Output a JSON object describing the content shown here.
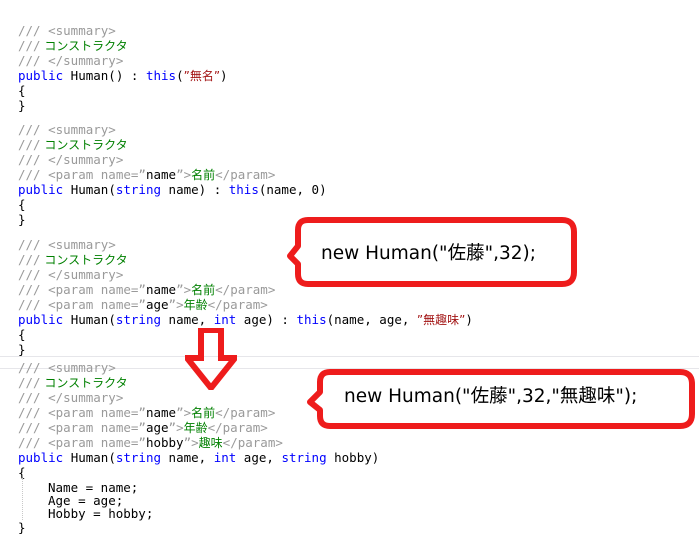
{
  "editor": {
    "language": "csharp",
    "background": "#ffffff",
    "colors": {
      "comment": "#9a9a9a",
      "comment_text": "#008000",
      "keyword": "#0000ff",
      "string": "#a31515",
      "plain": "#000000",
      "divider": "#e6e6ea",
      "indent_guide": "#c8c8c8",
      "annotation": "#ee1c1c"
    },
    "code_blocks": [
      {
        "name": "constructor-default",
        "lines": [
          {
            "slash": "///",
            "tag": " <summary>"
          },
          {
            "slash": "///",
            "jp": " コンストラクタ"
          },
          {
            "slash": "///",
            "tag": " </summary>"
          },
          {
            "signature": "public Human() : this(\"無名\")"
          },
          {
            "brace": "{"
          },
          {
            "brace": "}"
          }
        ]
      },
      {
        "name": "constructor-name",
        "lines": [
          {
            "slash": "///",
            "tag": " <summary>"
          },
          {
            "slash": "///",
            "jp": " コンストラクタ"
          },
          {
            "slash": "///",
            "tag": " </summary>"
          },
          {
            "slash": "///",
            "param": " <param name=\"name\">名前</param>"
          },
          {
            "signature": "public Human(string name) : this(name, 0)"
          },
          {
            "brace": "{"
          },
          {
            "brace": "}"
          }
        ]
      },
      {
        "name": "constructor-name-age",
        "lines": [
          {
            "slash": "///",
            "tag": " <summary>"
          },
          {
            "slash": "///",
            "jp": " コンストラクタ"
          },
          {
            "slash": "///",
            "tag": " </summary>"
          },
          {
            "slash": "///",
            "param": " <param name=\"name\">名前</param>"
          },
          {
            "slash": "///",
            "param": " <param name=\"age\">年齢</param>"
          },
          {
            "signature": "public Human(string name, int age) : this(name, age, \"無趣味\")"
          },
          {
            "brace": "{"
          },
          {
            "brace": "}"
          }
        ]
      },
      {
        "name": "constructor-name-age-hobby",
        "lines": [
          {
            "slash": "///",
            "tag": " <summary>"
          },
          {
            "slash": "///",
            "jp": " コンストラクタ"
          },
          {
            "slash": "///",
            "tag": " </summary>"
          },
          {
            "slash": "///",
            "param": " <param name=\"name\">名前</param>"
          },
          {
            "slash": "///",
            "param": " <param name=\"age\">年齢</param>"
          },
          {
            "slash": "///",
            "param": " <param name=\"hobby\">趣味</param>"
          },
          {
            "signature": "public Human(string name, int age, string hobby)"
          },
          {
            "brace": "{"
          },
          {
            "body": "Name = name;"
          },
          {
            "body": "Age = age;"
          },
          {
            "body": "Hobby = hobby;"
          },
          {
            "brace": "}"
          }
        ]
      }
    ],
    "tokens": {
      "slash": "///",
      "summary_open": " <summary>",
      "summary_close": " </summary>",
      "comment_jp": " コンストラクタ",
      "param_open_pre": " <param name=",
      "quote": "\"",
      "gt": ">",
      "param_close": "</param>",
      "param_name_name": "name",
      "param_name_age": "age",
      "param_name_hobby": "hobby",
      "param_jp_name": "名前",
      "param_jp_age": "年齢",
      "param_jp_hobby": "趣味",
      "kw_public": "public",
      "kw_this": "this",
      "kw_string": "string",
      "kw_int": "int",
      "type_human": "Human",
      "open_brace": "{",
      "close_brace": "}",
      "sig1_rest": " Human() : ",
      "sig1_args": "(\"無名\")",
      "str_muumei": "無名",
      "str_mushumi": "無趣味",
      "assign_name": "Name = name;",
      "assign_age": "Age = age;",
      "assign_hobby": "Hobby = hobby;"
    }
  },
  "annotations": {
    "arrow_down": {
      "name": "red-down-arrow",
      "color": "#ee1c1c"
    },
    "callouts": [
      {
        "id": "callout-1",
        "text": "new Human(\"佐藤\",32);",
        "border_color": "#ee1c1c",
        "fill": "#ffffff",
        "points_to": "constructor-name-age"
      },
      {
        "id": "callout-2",
        "text": "new Human(\"佐藤\",32,\"無趣味\");",
        "border_color": "#ee1c1c",
        "fill": "#ffffff",
        "points_to": "constructor-name-age-hobby"
      }
    ]
  }
}
